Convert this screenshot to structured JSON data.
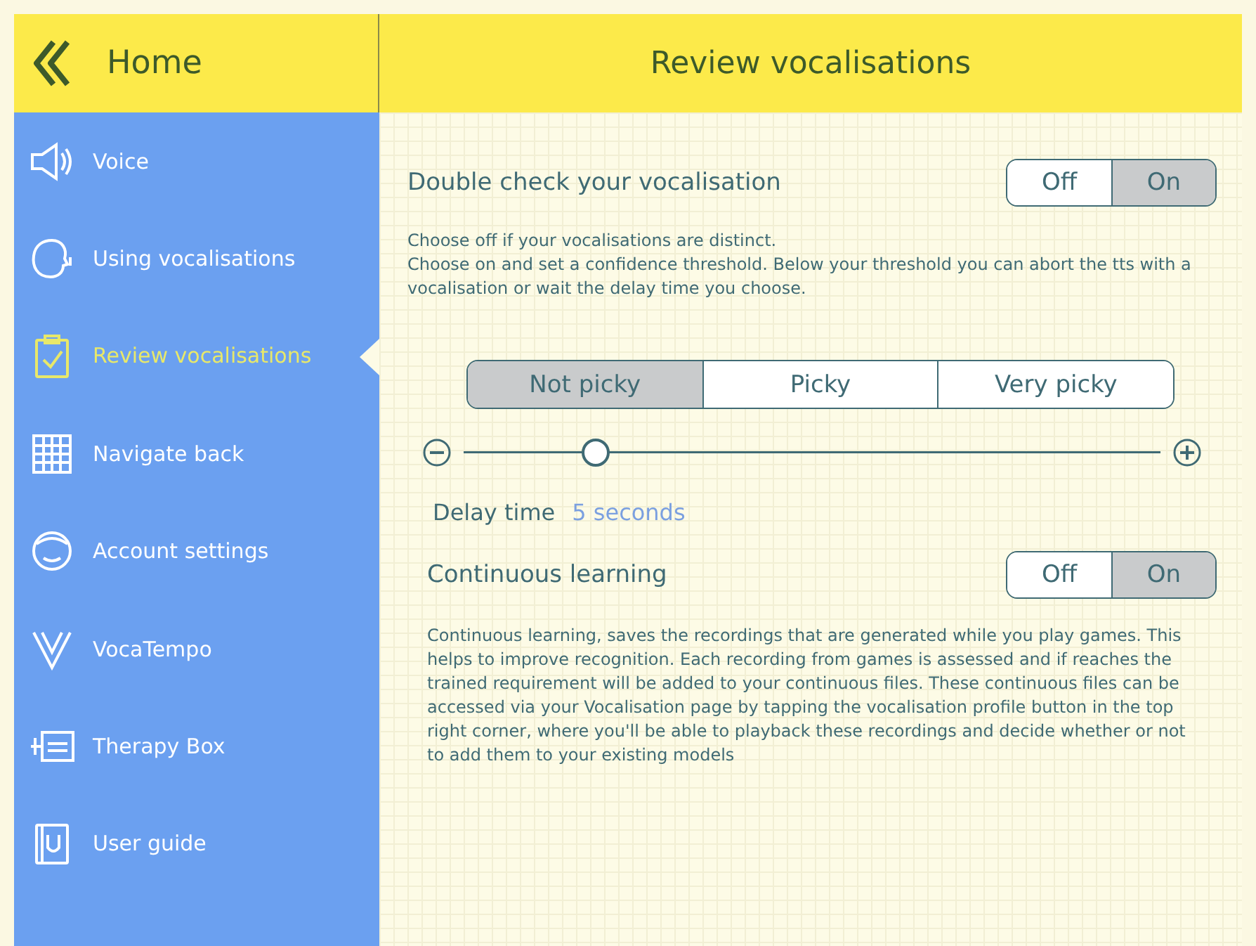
{
  "header": {
    "back_label": "Home",
    "title": "Review vocalisations"
  },
  "sidebar": {
    "items": [
      {
        "label": "Voice",
        "selected": false
      },
      {
        "label": "Using vocalisations",
        "selected": false
      },
      {
        "label": "Review vocalisations",
        "selected": true
      },
      {
        "label": "Navigate back",
        "selected": false
      },
      {
        "label": "Account settings",
        "selected": false
      },
      {
        "label": "VocaTempo",
        "selected": false
      },
      {
        "label": "Therapy Box",
        "selected": false
      },
      {
        "label": "User guide",
        "selected": false
      }
    ]
  },
  "double_check": {
    "label": "Double check your vocalisation",
    "options": [
      {
        "label": "Off",
        "selected": false
      },
      {
        "label": "On",
        "selected": true
      }
    ],
    "description": [
      "Choose off if your vocalisations are distinct.",
      "Choose on and set a confidence threshold. Below your threshold you can abort the tts with a vocalisation or wait the delay time you choose."
    ]
  },
  "pickiness": [
    {
      "label": "Not picky",
      "selected": true
    },
    {
      "label": "Picky",
      "selected": false
    },
    {
      "label": "Very picky",
      "selected": false
    }
  ],
  "delay": {
    "level": 0.19,
    "label": "Delay time",
    "value": "5 seconds"
  },
  "continuous_learning": {
    "label": "Continuous learning",
    "options": [
      {
        "label": "Off",
        "selected": false
      },
      {
        "label": "On",
        "selected": true
      }
    ],
    "description": "Continuous learning, saves the recordings that are generated while you play games. This helps to improve recognition. Each recording from games is assessed and if reaches the trained requirement will be added to your continuous files. These continuous files can be accessed via your Vocalisation page by tapping the vocalisation profile button in the top right corner, where you'll be able to playback these recordings and decide whether or not to add them to your existing models"
  }
}
